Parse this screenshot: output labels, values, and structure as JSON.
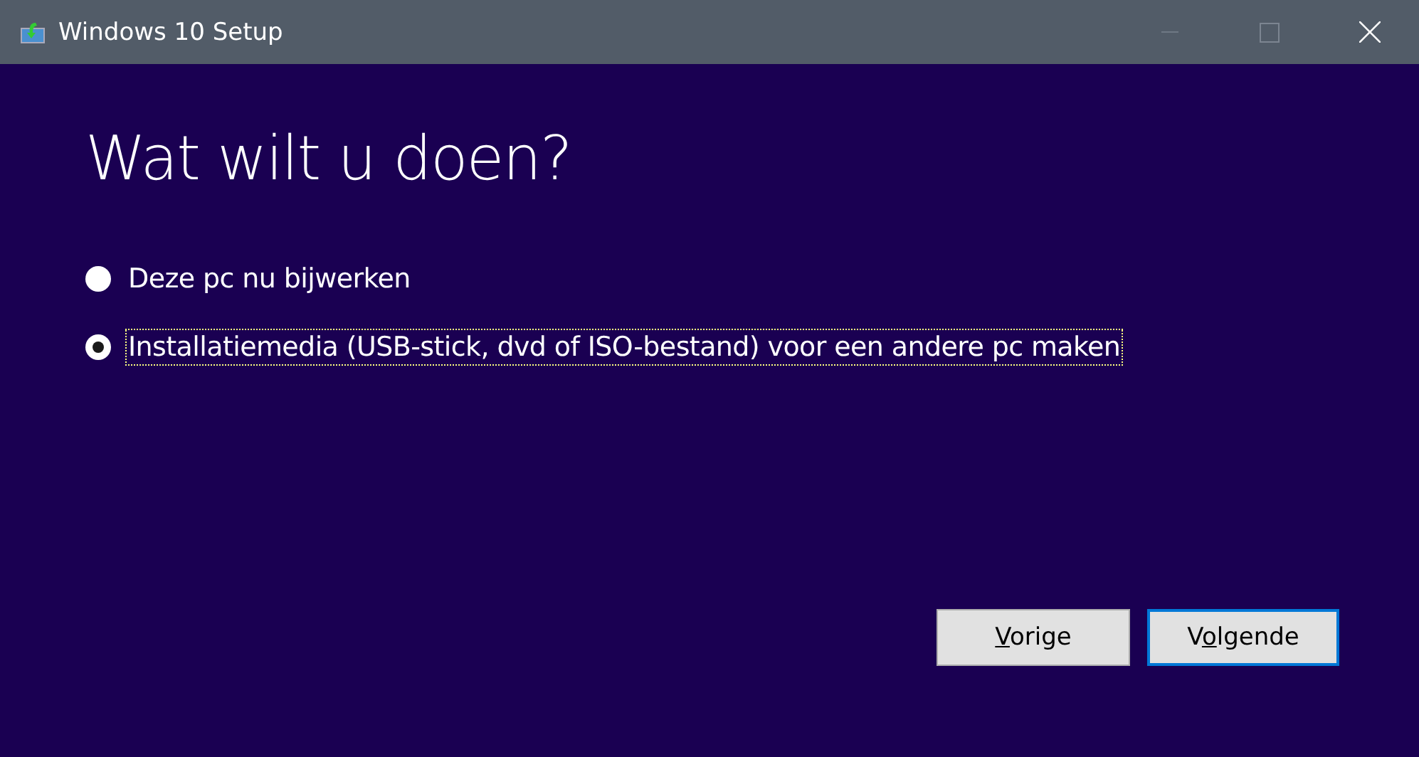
{
  "window": {
    "title": "Windows 10 Setup"
  },
  "heading": "Wat wilt u doen?",
  "options": [
    {
      "label": "Deze pc nu bijwerken",
      "selected": false,
      "focused": false
    },
    {
      "label": "Installatiemedia (USB-stick, dvd of ISO-bestand) voor een andere pc maken",
      "selected": true,
      "focused": true
    }
  ],
  "buttons": [
    {
      "access_key": "V",
      "label_after": "orige",
      "default": false
    },
    {
      "label_before": "V",
      "access_key": "o",
      "label_after": "lgende",
      "default": true
    }
  ]
}
